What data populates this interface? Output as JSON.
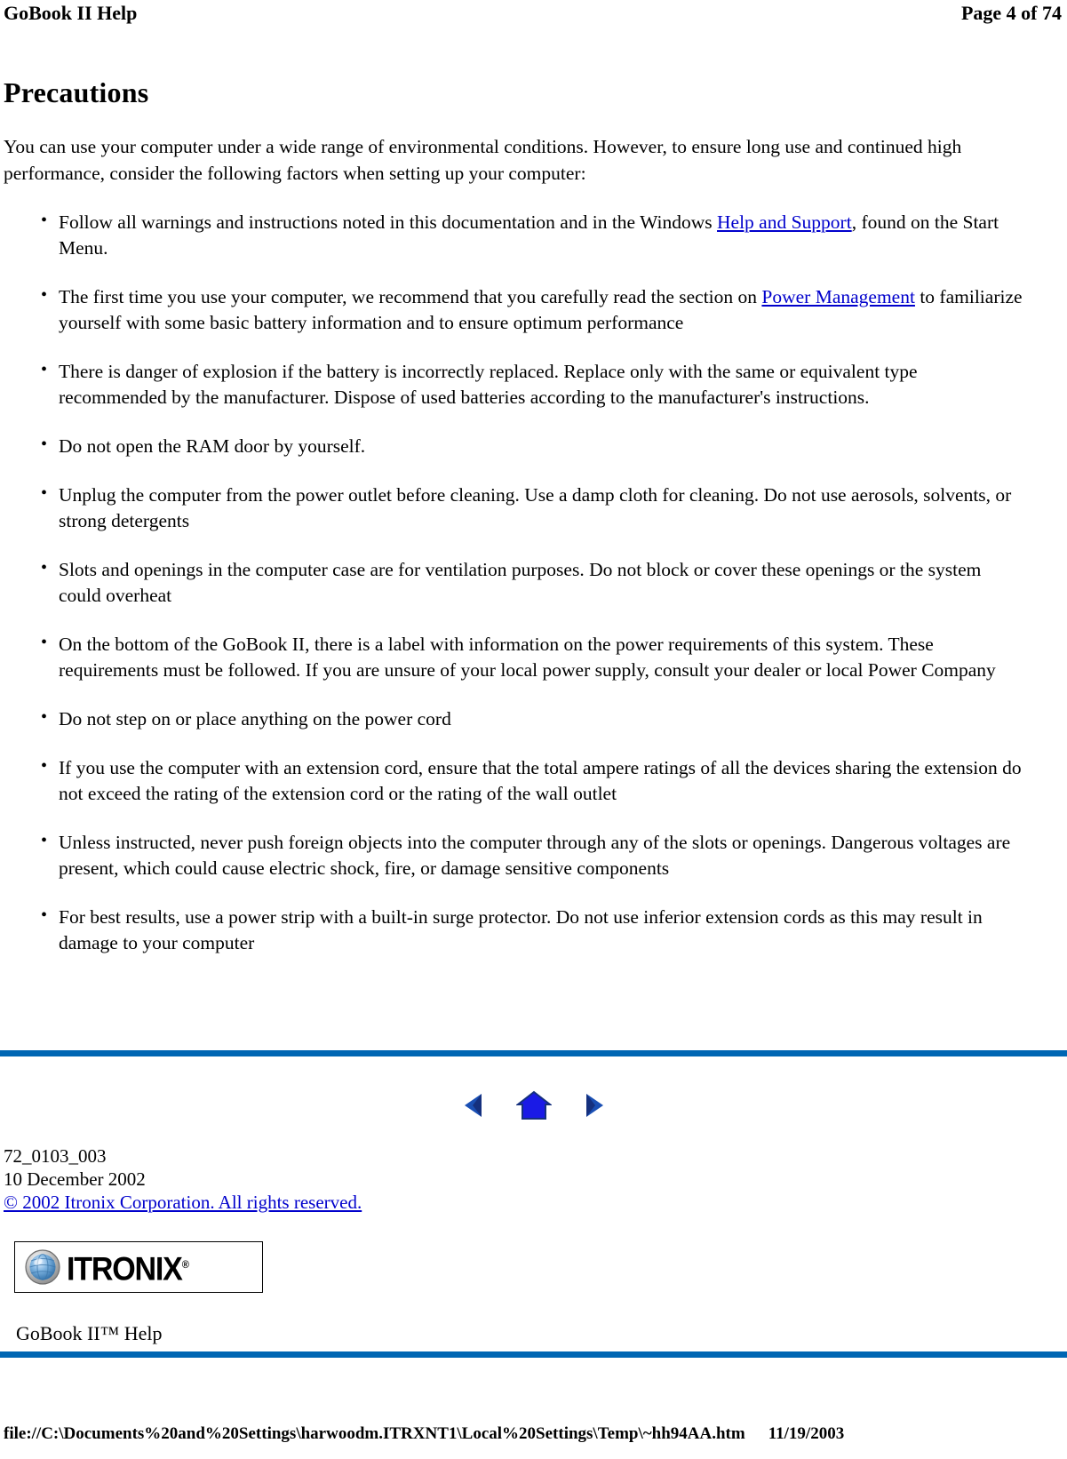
{
  "header": {
    "title": "GoBook II Help",
    "page_indicator": "Page 4 of 74"
  },
  "main": {
    "heading": "Precautions",
    "intro": "You can use your computer under a wide range of environmental conditions. However, to ensure long use and continued high performance, consider the following factors when setting up your computer:",
    "bullets": [
      {
        "pre": "Follow all warnings and instructions noted in this documentation and in the Windows ",
        "link": "Help and Support",
        "post": ", found on the Start Menu."
      },
      {
        "pre": "The first time you use your computer, we recommend that you carefully read the section on  ",
        "link": "Power Management",
        "post": " to familiarize yourself with some basic battery information and to ensure optimum performance"
      },
      {
        "pre": "There is danger of explosion if the battery is incorrectly replaced.  Replace only with the same or equivalent type recommended by the manufacturer.  Dispose of used batteries according to the manufacturer's instructions.",
        "link": "",
        "post": ""
      },
      {
        "pre": "Do not open the RAM door by yourself.",
        "link": "",
        "post": ""
      },
      {
        "pre": "Unplug the computer from the power outlet before cleaning. Use a damp cloth for cleaning. Do not use aerosols, solvents, or strong detergents",
        "link": "",
        "post": ""
      },
      {
        "pre": "Slots and openings in the computer case are for ventilation purposes. Do not block or cover these openings or the system could overheat",
        "link": "",
        "post": ""
      },
      {
        "pre": "On the bottom of the GoBook II, there is a label with information on the power requirements of this system. These requirements must be followed. If you are unsure of your local power supply, consult your dealer or local Power Company",
        "link": "",
        "post": ""
      },
      {
        "pre": "Do not step on or place anything on the power cord",
        "link": "",
        "post": ""
      },
      {
        "pre": "If you use the computer with an extension cord, ensure that the total ampere ratings of all the devices sharing the extension do not exceed the rating of the extension cord or the rating of the wall outlet",
        "link": "",
        "post": ""
      },
      {
        "pre": "Unless instructed, never push foreign objects into the computer through any of the slots or openings. Dangerous voltages are present, which could cause electric shock,  fire, or damage sensitive components",
        "link": "",
        "post": ""
      },
      {
        "pre": "For best results, use a power strip with a built-in surge protector. Do not use inferior extension cords as this may result in damage to your computer",
        "link": "",
        "post": ""
      }
    ]
  },
  "navigation": {
    "back_icon": "back-arrow-icon",
    "home_icon": "home-icon",
    "forward_icon": "forward-arrow-icon"
  },
  "footer": {
    "doc_number": "72_0103_003",
    "doc_date": "10 December 2002",
    "copyright": "© 2002 Itronix Corporation.  All rights reserved.",
    "logo_text": "ITRONIX",
    "logo_trademark": "®",
    "logo_icon": "globe-icon",
    "product_label": "GoBook II™ Help"
  },
  "status_bar": {
    "file_path": "file://C:\\Documents%20and%20Settings\\harwoodm.ITRXNT1\\Local%20Settings\\Temp\\~hh94AA.htm",
    "date": "11/19/2003"
  },
  "colors": {
    "rule_blue": "#0066b3",
    "link_blue": "#0000cc",
    "nav_blue": "#1a1ae6"
  }
}
